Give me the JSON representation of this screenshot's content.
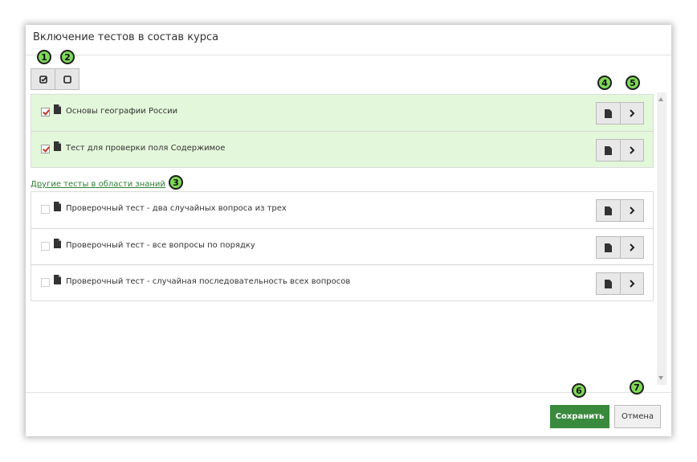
{
  "dialog": {
    "title": "Включение тестов в состав курса"
  },
  "annotations": [
    "1",
    "2",
    "3",
    "4",
    "5",
    "6",
    "7"
  ],
  "toolbar": {
    "select_all_icon": "check-square-icon",
    "deselect_all_icon": "square-icon"
  },
  "selected_tests": [
    {
      "label": "Основы географии России",
      "checked": true
    },
    {
      "label": "Тест для проверки поля Содержимое",
      "checked": true
    }
  ],
  "other_tests_link": "Другие тесты в области знаний",
  "other_tests": [
    {
      "label": "Проверочный тест - два случайных вопроса из трех",
      "checked": false
    },
    {
      "label": "Проверочный тест - все вопросы по порядку",
      "checked": false
    },
    {
      "label": "Проверочный тест - случайная последовательность всех вопросов",
      "checked": false
    }
  ],
  "row_actions": {
    "document_icon": "document-icon",
    "next_icon": "chevron-right-icon"
  },
  "footer": {
    "save_label": "Сохранить",
    "cancel_label": "Отмена"
  },
  "colors": {
    "selected_bg": "#e3f7da",
    "save_bg": "#3a8a3e",
    "badge": "#7ed957",
    "link": "#2e7d32"
  }
}
